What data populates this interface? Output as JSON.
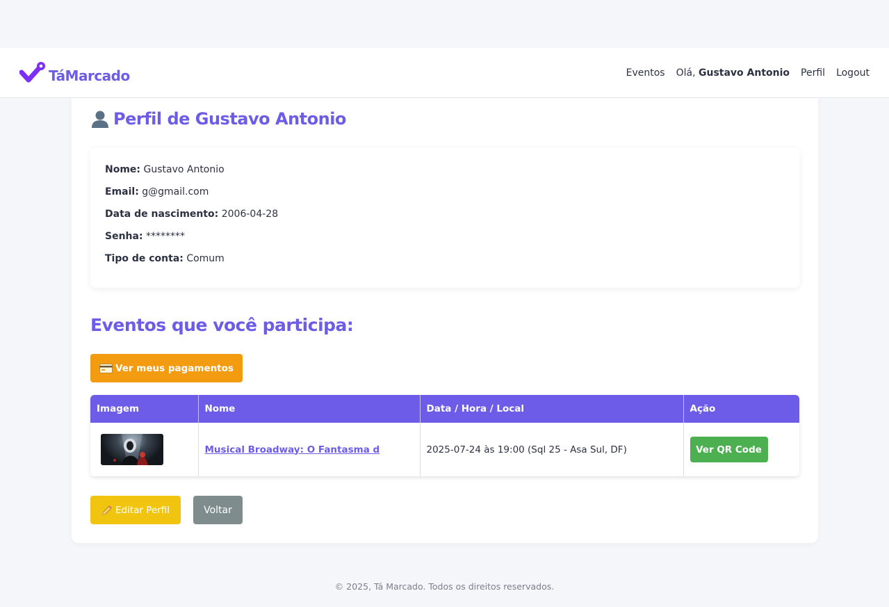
{
  "navbar": {
    "brand": "TáMarcado",
    "links": {
      "events": "Eventos",
      "greeting_prefix": "Olá,",
      "greeting_name": "Gustavo Antonio",
      "profile": "Perfil",
      "logout": "Logout"
    }
  },
  "profile": {
    "title": "Perfil de Gustavo Antonio",
    "fields": [
      {
        "label": "Nome:",
        "value": "Gustavo Antonio"
      },
      {
        "label": "Email:",
        "value": "g@gmail.com"
      },
      {
        "label": "Data de nascimento:",
        "value": "2006-04-28"
      },
      {
        "label": "Senha:",
        "value": "********"
      },
      {
        "label": "Tipo de conta:",
        "value": "Comum"
      }
    ]
  },
  "events": {
    "section_title": "Eventos que você participa:",
    "payments_button": "Ver meus pagamentos",
    "table": {
      "headers": [
        "Imagem",
        "Nome",
        "Data / Hora / Local",
        "Ação"
      ],
      "rows": [
        {
          "name": "Musical Broadway: O Fantasma d",
          "datetime_location": "2025-07-24 às 19:00 (Sql 25 - Asa Sul, DF)",
          "action": "Ver QR Code"
        }
      ]
    }
  },
  "actions": {
    "edit_profile": "Editar Perfil",
    "back": "Voltar"
  },
  "footer": "© 2025, Tá Marcado. Todos os direitos reservados.",
  "colors": {
    "brand": "#6c5ce7",
    "pay_button": "#f39c12",
    "edit_button": "#f1c40f",
    "back_button": "#7f8c8d",
    "qr_button": "#4caf50"
  },
  "icons": {
    "logo": "check-pin-icon",
    "title": "user-bust-icon",
    "payments": "credit-card-icon",
    "edit": "pencil-icon"
  }
}
